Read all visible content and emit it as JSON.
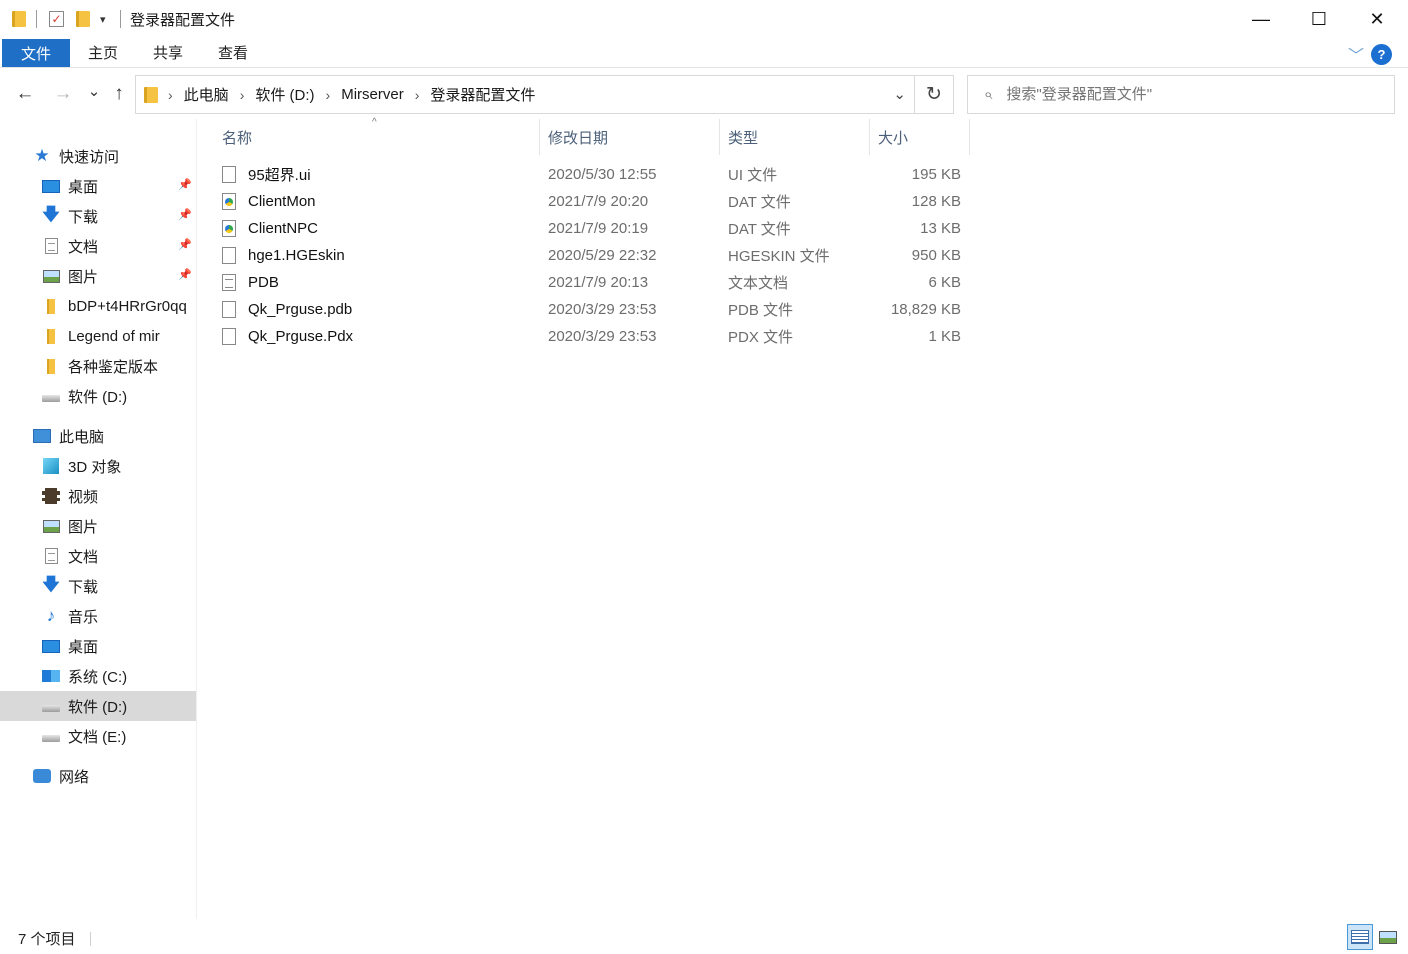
{
  "window": {
    "title": "登录器配置文件",
    "minimize": "—",
    "maximize": "☐",
    "close": "✕"
  },
  "ribbon": {
    "tabs": [
      {
        "label": "文件",
        "active": true
      },
      {
        "label": "主页"
      },
      {
        "label": "共享"
      },
      {
        "label": "查看"
      }
    ],
    "help": "?",
    "expand": "﹀"
  },
  "nav": {
    "back": "←",
    "forward": "→",
    "recent": "⌄",
    "up": "↑",
    "breadcrumb": [
      "此电脑",
      "软件 (D:)",
      "Mirserver",
      "登录器配置文件"
    ],
    "crumb_sep": "›",
    "dropdown": "⌄",
    "refresh": "↻",
    "search_placeholder": "搜索\"登录器配置文件\""
  },
  "sidebar": {
    "quick_access": "快速访问",
    "quick_items": [
      {
        "label": "桌面",
        "icon": "desktop-icon",
        "pinned": true
      },
      {
        "label": "下载",
        "icon": "download-icon",
        "pinned": true
      },
      {
        "label": "文档",
        "icon": "document-icon",
        "pinned": true
      },
      {
        "label": "图片",
        "icon": "picture-icon",
        "pinned": true
      },
      {
        "label": "bDP+t4HRrGr0qq",
        "icon": "folder-icon"
      },
      {
        "label": "Legend of mir",
        "icon": "folder-icon"
      },
      {
        "label": "各种鉴定版本",
        "icon": "folder-icon"
      },
      {
        "label": "软件 (D:)",
        "icon": "drive-icon"
      }
    ],
    "this_pc": "此电脑",
    "pc_items": [
      {
        "label": "3D 对象",
        "icon": "3d-objects-icon"
      },
      {
        "label": "视频",
        "icon": "video-icon"
      },
      {
        "label": "图片",
        "icon": "picture-icon"
      },
      {
        "label": "文档",
        "icon": "document-icon"
      },
      {
        "label": "下载",
        "icon": "download-icon"
      },
      {
        "label": "音乐",
        "icon": "music-icon"
      },
      {
        "label": "桌面",
        "icon": "desktop-icon"
      },
      {
        "label": "系统 (C:)",
        "icon": "system-drive-icon"
      },
      {
        "label": "软件 (D:)",
        "icon": "drive-icon",
        "selected": true
      },
      {
        "label": "文档 (E:)",
        "icon": "drive-icon"
      }
    ],
    "network": "网络"
  },
  "columns": {
    "name": "名称",
    "date": "修改日期",
    "type": "类型",
    "size": "大小",
    "sort_indicator": "^"
  },
  "files": [
    {
      "name": "95超界.ui",
      "date": "2020/5/30 12:55",
      "type": "UI 文件",
      "size": "195 KB",
      "icon": "generic-file-icon"
    },
    {
      "name": "ClientMon",
      "date": "2021/7/9 20:20",
      "type": "DAT 文件",
      "size": "128 KB",
      "icon": "media-file-icon"
    },
    {
      "name": "ClientNPC",
      "date": "2021/7/9 20:19",
      "type": "DAT 文件",
      "size": "13 KB",
      "icon": "media-file-icon"
    },
    {
      "name": "hge1.HGEskin",
      "date": "2020/5/29 22:32",
      "type": "HGESKIN 文件",
      "size": "950 KB",
      "icon": "generic-file-icon"
    },
    {
      "name": "PDB",
      "date": "2021/7/9 20:13",
      "type": "文本文档",
      "size": "6 KB",
      "icon": "text-file-icon"
    },
    {
      "name": "Qk_Prguse.pdb",
      "date": "2020/3/29 23:53",
      "type": "PDB 文件",
      "size": "18,829 KB",
      "icon": "generic-file-icon"
    },
    {
      "name": "Qk_Prguse.Pdx",
      "date": "2020/3/29 23:53",
      "type": "PDX 文件",
      "size": "1 KB",
      "icon": "generic-file-icon"
    }
  ],
  "status": {
    "item_count": "7 个项目"
  }
}
